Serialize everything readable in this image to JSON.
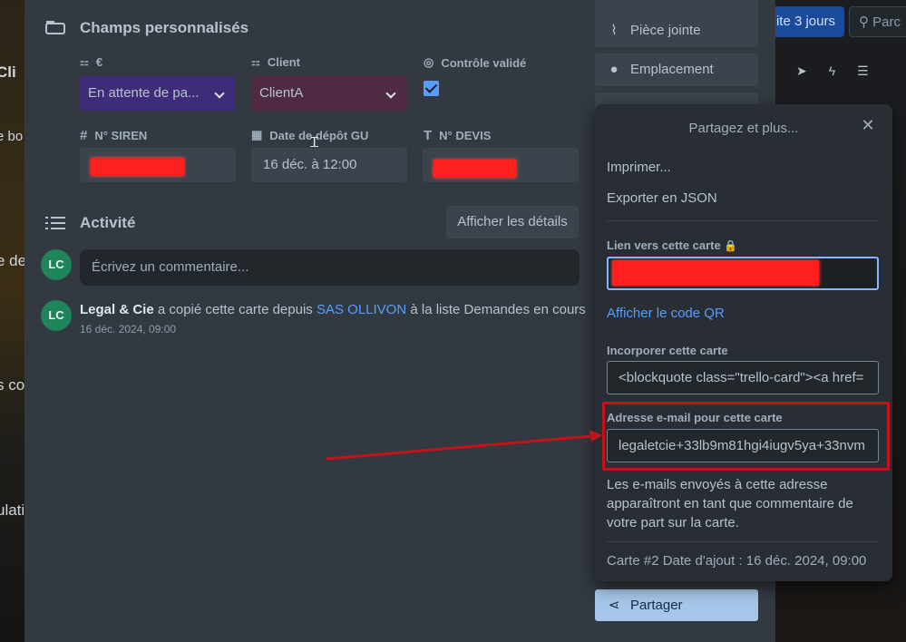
{
  "background": {
    "left_texts": [
      "Cli",
      "e bo",
      "e de",
      "s co",
      "ulati"
    ],
    "top_buttons": {
      "trial": "ite 3 jours",
      "search": "Parc"
    }
  },
  "custom_fields": {
    "title": "Champs personnalisés",
    "fields": [
      {
        "label": "€",
        "value": "En attente de pa...",
        "color": "#3f2c78"
      },
      {
        "label": "Client",
        "value": "ClientA",
        "color": "#4f2a42"
      },
      {
        "label": "Contrôle validé",
        "checked": true
      },
      {
        "label": "N° SIREN",
        "value": ""
      },
      {
        "label": "Date de dépôt GU",
        "value": "16 déc. à 12:00"
      },
      {
        "label": "N° DEVIS",
        "value": ""
      }
    ]
  },
  "activity": {
    "title": "Activité",
    "details_button": "Afficher les détails",
    "avatar_initials": "LC",
    "comment_placeholder": "Écrivez un commentaire...",
    "entry": {
      "author": "Legal & Cie",
      "text1": " a copié cette carte depuis ",
      "board": "SAS OLLIVON",
      "text2": " à la liste Demandes en cours",
      "timestamp": "16 déc. 2024, 09:00"
    }
  },
  "sidebar": {
    "attachment": "Pièce jointe",
    "location": "Emplacement",
    "share": "Partager"
  },
  "share_popover": {
    "title": "Partagez et plus...",
    "print": "Imprimer...",
    "export_json": "Exporter en JSON",
    "card_link_label": "Lien vers cette carte",
    "qr_link": "Afficher le code QR",
    "embed_label": "Incorporer cette carte",
    "embed_value": "<blockquote class=\"trello-card\"><a href=",
    "email_label": "Adresse e-mail pour cette carte",
    "email_value": "legaletcie+33lb9m81hgi4iugv5ya+33nvm",
    "email_description": "Les e-mails envoyés à cette adresse apparaîtront en tant que commentaire de votre part sur la carte.",
    "footer": "Carte #2  Date d'ajout : 16 déc. 2024, 09:00"
  },
  "colors": {
    "accent": "#579dff",
    "annotation": "#c4121a",
    "redaction": "#ff1f1f"
  }
}
